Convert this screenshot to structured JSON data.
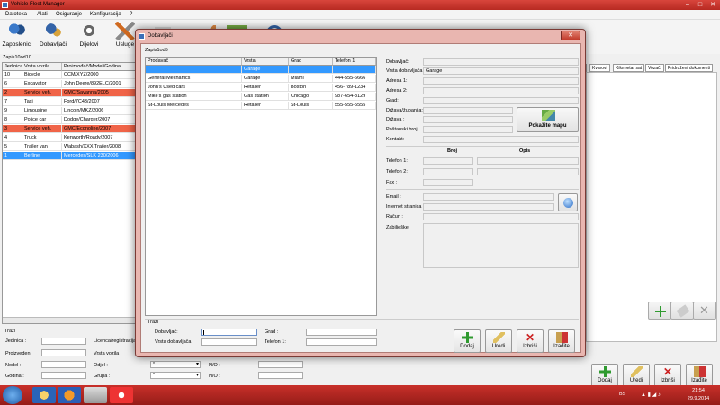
{
  "app": {
    "title": "Vehicle Fleet Manager",
    "menu": [
      "Datoteka",
      "Alati",
      "Osiguranje",
      "Konfiguracija",
      "?"
    ],
    "toolbar": [
      "Zaposlenici",
      "Dobavljači",
      "Dijelovi",
      "Usluge"
    ]
  },
  "main_grid": {
    "record_count": "Zapis10od10",
    "columns": [
      "Jedinica",
      "Vrsta vozila",
      "Proizvođač/Model/Godina"
    ],
    "rows": [
      {
        "id": "10",
        "type": "Bicycle",
        "model": "CCM/XYZ/2000",
        "state": "normal"
      },
      {
        "id": "6",
        "type": "Excavator",
        "model": "John Deere/892ELC/2001",
        "state": "normal"
      },
      {
        "id": "2",
        "type": "Service veh.",
        "model": "GMC/Savanna/2005",
        "state": "red"
      },
      {
        "id": "7",
        "type": "Taxi",
        "model": "Ford/7C43/2007",
        "state": "normal"
      },
      {
        "id": "9",
        "type": "Limousine",
        "model": "Lincoln/MKZ/2006",
        "state": "normal"
      },
      {
        "id": "8",
        "type": "Police car",
        "model": "Dodge/Charger/2007",
        "state": "normal"
      },
      {
        "id": "3",
        "type": "Service veh.",
        "model": "GMC/Econoline/2007",
        "state": "red"
      },
      {
        "id": "4",
        "type": "Truck",
        "model": "Kenworth/Roady/2007",
        "state": "normal"
      },
      {
        "id": "5",
        "type": "Trailer van",
        "model": "Wabash/XXX Trailer/2008",
        "state": "normal"
      },
      {
        "id": "1",
        "type": "Berline",
        "model": "Mercedes/SLK 230/2006",
        "state": "selected"
      }
    ]
  },
  "right_tabs": [
    "Kvarovi",
    "Kilometar sat",
    "Vozači",
    "Pridruženi dokumenti"
  ],
  "search_main": {
    "title": "Traži",
    "labels": [
      "Jedinica :",
      "Proizveden:",
      "Nodel :",
      "Godina :",
      "Licenca/registracija",
      "Vrsta vozila",
      "Odjel :",
      "Grupa :",
      "N/O :",
      "N/O :"
    ],
    "combo_value": "*"
  },
  "main_actions": [
    "Dodaj",
    "Uredi",
    "Izbriši",
    "Izađite"
  ],
  "dialog": {
    "title": "Dobavljači",
    "record_count": "Zapis1od5",
    "columns": [
      "Prodavač",
      "Vrsta",
      "Grad",
      "Telefon 1"
    ],
    "rows": [
      {
        "name": "",
        "type": "Garage",
        "city": "",
        "phone": "",
        "state": "selected"
      },
      {
        "name": "General Mechanics",
        "type": "Garage",
        "city": "Miami",
        "phone": "444-555-6666",
        "state": "normal"
      },
      {
        "name": "John's Used cars",
        "type": "Retailer",
        "city": "Boston",
        "phone": "456-789-1234",
        "state": "normal"
      },
      {
        "name": "Mike's gas station",
        "type": "Gas station",
        "city": "Chicago",
        "phone": "987-654-3129",
        "state": "normal"
      },
      {
        "name": "St-Louis Mercedes",
        "type": "Retailer",
        "city": "St-Louis",
        "phone": "555-555-5555",
        "state": "normal"
      }
    ],
    "details": {
      "labels": [
        "Dobavljač:",
        "Vrsta dobavljača:",
        "Adresa 1:",
        "Adresa 2:",
        "Grad:",
        "Država/županija:",
        "Država :",
        "Poštanski broj:",
        "Kontakt:",
        "Telefon 1:",
        "Telefon 2:",
        "Fax :",
        "Email :",
        "Internet stranica :",
        "Račun :",
        "Zabilješke:"
      ],
      "vrsta_value": "Garage",
      "broj_header": "Broj",
      "opis_header": "Opis",
      "map_button": "Pokažite mapu"
    },
    "search": {
      "title": "Traži",
      "labels": [
        "Dobavljač:",
        "Vrsta dobavljača",
        "Grad :",
        "Telefon 1:"
      ]
    },
    "actions": [
      "Dodaj",
      "Uredi",
      "Izbriši",
      "Izađite"
    ]
  },
  "taskbar": {
    "lang": "BS",
    "time": "21:54",
    "date": "29.9.2014"
  }
}
